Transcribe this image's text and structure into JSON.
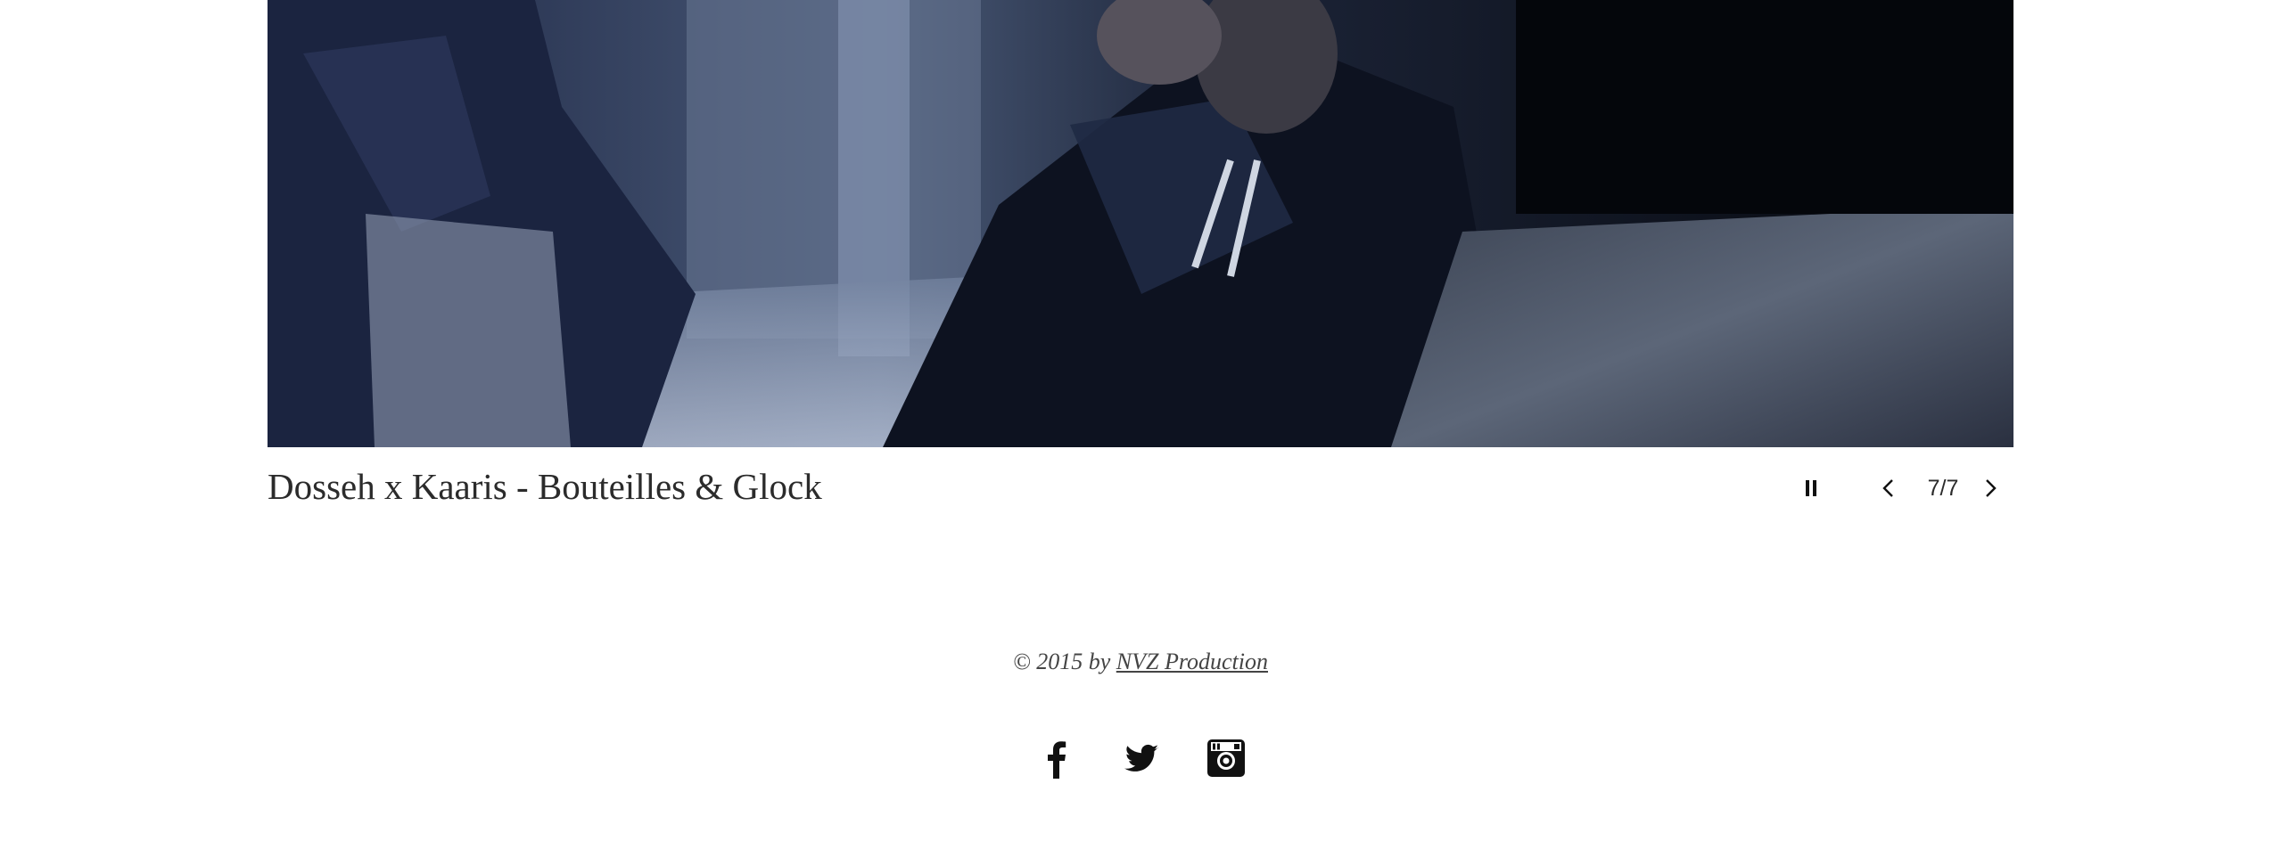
{
  "slideshow": {
    "title": "Dosseh x Kaaris - Bouteilles & Glock",
    "counter": "7/7",
    "controls": {
      "pause_icon": "pause-icon",
      "prev_icon": "chevron-left-icon",
      "next_icon": "chevron-right-icon"
    }
  },
  "footer": {
    "copyright_prefix": "© 2015 by ",
    "copyright_link": "NVZ Production",
    "social": [
      {
        "name": "facebook",
        "icon": "facebook-icon"
      },
      {
        "name": "twitter",
        "icon": "twitter-icon"
      },
      {
        "name": "instagram",
        "icon": "instagram-icon"
      }
    ]
  },
  "colors": {
    "text": "#2b2b2b",
    "icon": "#111111",
    "background": "#ffffff"
  }
}
